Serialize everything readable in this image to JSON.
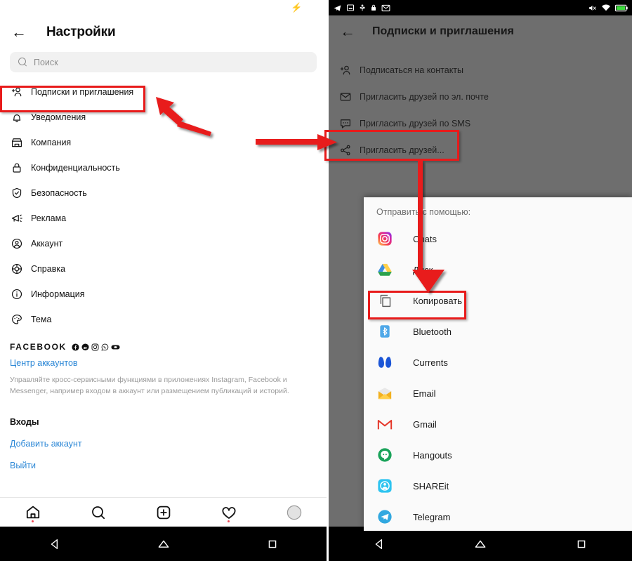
{
  "left_phone": {
    "statusbar": {
      "charging_icon": "lightning-bolt-icon",
      "charging_color": "#22bb22"
    },
    "header": {
      "back_icon": "back-arrow-icon",
      "title": "Настройки"
    },
    "search": {
      "icon": "search-icon",
      "placeholder": "Поиск",
      "value": ""
    },
    "settings_items": [
      {
        "icon": "add-person-icon",
        "label": "Подписки и приглашения"
      },
      {
        "icon": "bell-icon",
        "label": "Уведомления"
      },
      {
        "icon": "storefront-icon",
        "label": "Компания"
      },
      {
        "icon": "lock-icon",
        "label": "Конфиденциальность"
      },
      {
        "icon": "shield-check-icon",
        "label": "Безопасность"
      },
      {
        "icon": "megaphone-icon",
        "label": "Реклама"
      },
      {
        "icon": "person-circle-icon",
        "label": "Аккаунт"
      },
      {
        "icon": "lifebuoy-icon",
        "label": "Справка"
      },
      {
        "icon": "info-circle-icon",
        "label": "Информация"
      },
      {
        "icon": "palette-icon",
        "label": "Тема"
      }
    ],
    "facebook_section": {
      "brand_word": "FACEBOOK",
      "brand_icons": [
        "facebook-icon",
        "messenger-icon",
        "instagram-icon",
        "whatsapp-icon",
        "oculus-icon"
      ],
      "accounts_center_link": "Центр аккаунтов",
      "description": "Управляйте кросс-сервисными функциями в приложениях Instagram, Facebook и Messenger, например входом в аккаунт или размещением публикаций и историй.",
      "logins_heading": "Входы",
      "add_account_link": "Добавить аккаунт",
      "logout_link": "Выйти",
      "link_color": "#2b87d6"
    },
    "tabbar": [
      {
        "icon": "home-icon",
        "badge": true
      },
      {
        "icon": "search-icon",
        "badge": false
      },
      {
        "icon": "add-square-icon",
        "badge": false
      },
      {
        "icon": "heart-icon",
        "badge": true
      },
      {
        "icon": "avatar-icon",
        "badge": false
      }
    ],
    "navbar": [
      {
        "icon": "android-back-icon"
      },
      {
        "icon": "android-home-icon"
      },
      {
        "icon": "android-recents-icon"
      }
    ]
  },
  "right_phone": {
    "statusbar": {
      "left_icons": [
        "telegram-icon",
        "screenshot-icon",
        "usb-icon",
        "lock-icon",
        "gmail-icon"
      ],
      "right_icons": [
        "mute-icon",
        "wifi-icon",
        "battery-charging-icon"
      ]
    },
    "header": {
      "back_icon": "back-arrow-icon",
      "title": "Подписки и приглашения"
    },
    "menu_items": [
      {
        "icon": "add-person-icon",
        "label": "Подписаться на контакты"
      },
      {
        "icon": "envelope-icon",
        "label": "Пригласить друзей по эл. почте"
      },
      {
        "icon": "chat-dots-icon",
        "label": "Пригласить друзей по SMS"
      },
      {
        "icon": "share-nodes-icon",
        "label": "Пригласить друзей..."
      }
    ],
    "share_sheet": {
      "title": "Отправить с помощью:",
      "items": [
        {
          "icon": "instagram-icon",
          "label": "Chats"
        },
        {
          "icon": "google-drive-icon",
          "label": "Диск"
        },
        {
          "icon": "copy-icon",
          "label": "Копировать"
        },
        {
          "icon": "bluetooth-icon",
          "label": "Bluetooth"
        },
        {
          "icon": "currents-icon",
          "label": "Currents"
        },
        {
          "icon": "email-icon",
          "label": "Email"
        },
        {
          "icon": "gmail-icon",
          "label": "Gmail"
        },
        {
          "icon": "hangouts-icon",
          "label": "Hangouts"
        },
        {
          "icon": "shareit-icon",
          "label": "SHAREit"
        },
        {
          "icon": "telegram-icon",
          "label": "Telegram"
        }
      ]
    },
    "navbar": [
      {
        "icon": "android-back-icon"
      },
      {
        "icon": "android-home-icon"
      },
      {
        "icon": "android-recents-icon"
      }
    ]
  },
  "annotations": {
    "highlight_color": "#e81b1b",
    "highlights": [
      {
        "name": "highlight-follow-and-invite"
      },
      {
        "name": "highlight-invite-friends"
      },
      {
        "name": "highlight-copy"
      }
    ],
    "arrows": [
      {
        "name": "arrow-to-follow-and-invite",
        "direction": "up-left"
      },
      {
        "name": "arrow-to-invite-friends",
        "direction": "right"
      },
      {
        "name": "arrow-to-share-sheet",
        "direction": "down"
      },
      {
        "name": "arrow-to-copy",
        "direction": "down"
      }
    ]
  }
}
